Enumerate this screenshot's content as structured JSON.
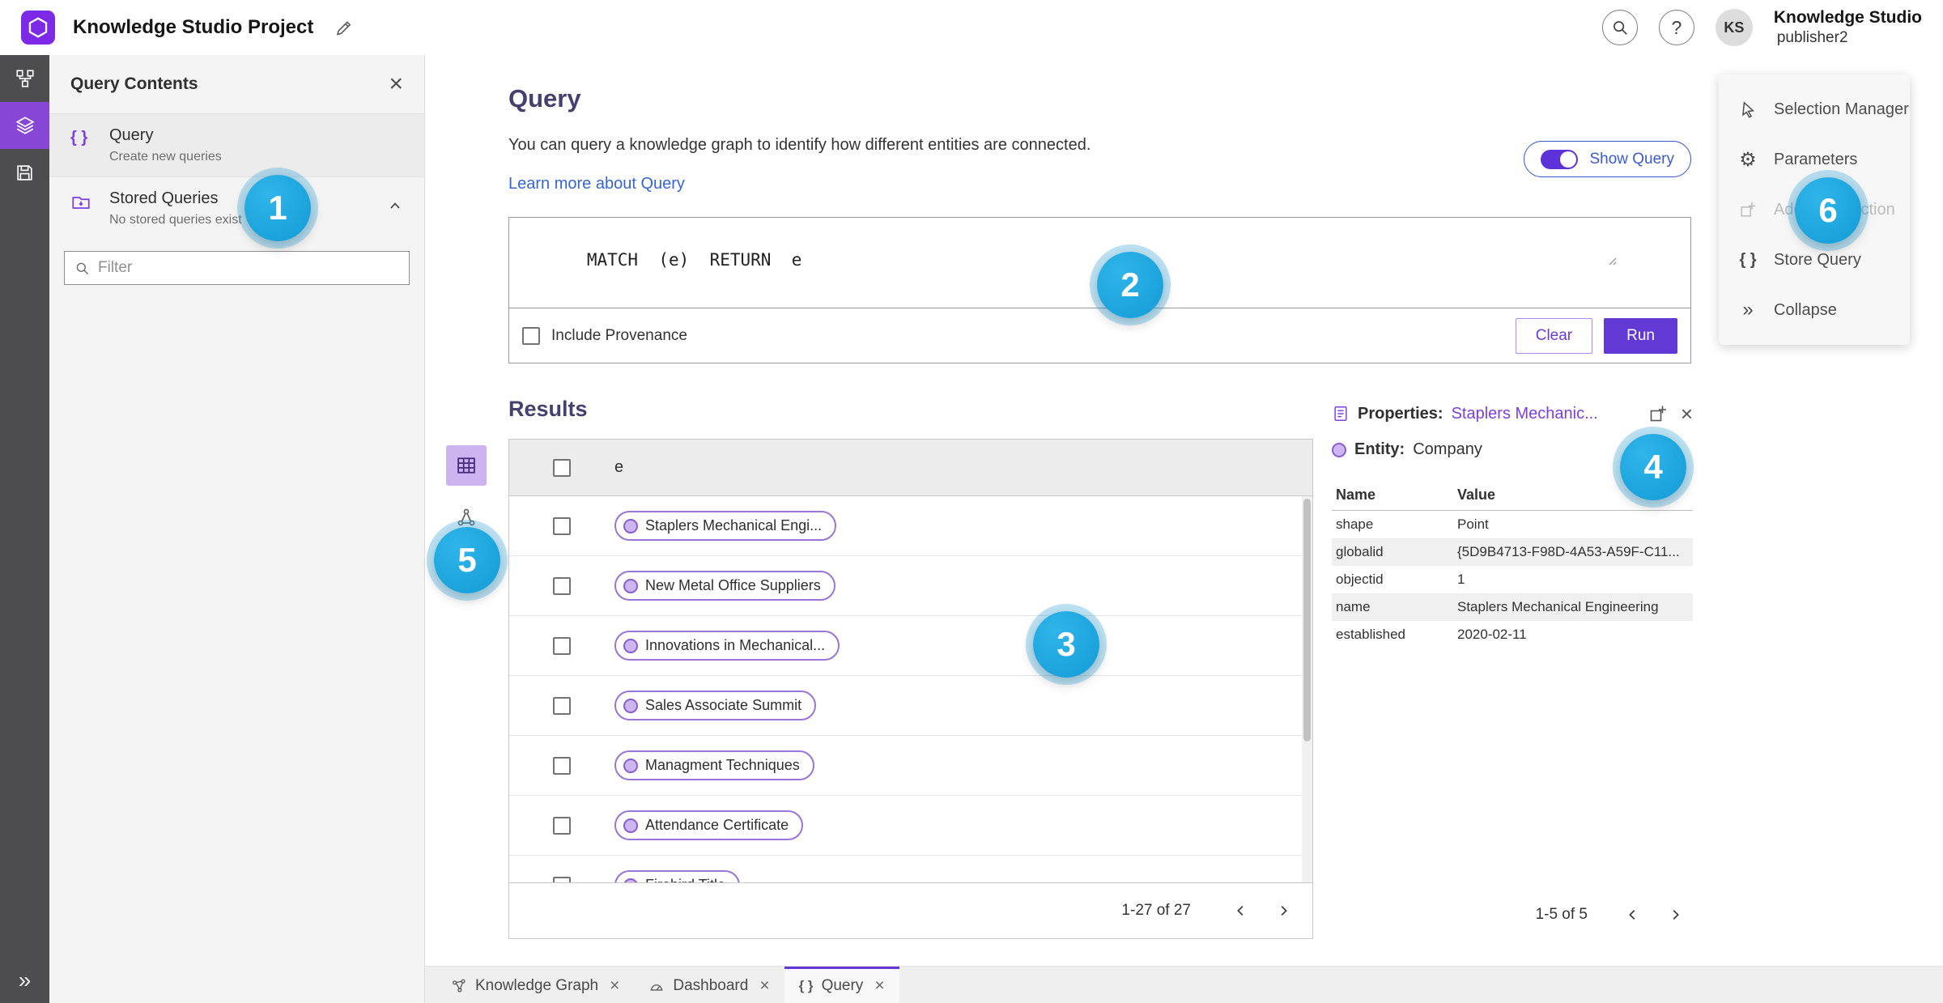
{
  "topbar": {
    "title": "Knowledge Studio Project",
    "help_glyph": "?",
    "avatar_initials": "KS",
    "user_name": "Knowledge Studio",
    "user_role": "publisher2"
  },
  "icons": {
    "close": "×",
    "collapse": "»",
    "braces": "{ }",
    "gear": "⚙"
  },
  "left_panel": {
    "title": "Query Contents",
    "items": [
      {
        "label": "Query",
        "sublabel": "Create new queries"
      },
      {
        "label": "Stored Queries",
        "sublabel": "No stored queries exist"
      }
    ],
    "filter_placeholder": "Filter"
  },
  "query": {
    "heading": "Query",
    "description": "You can query a knowledge graph to identify how different entities are connected.",
    "learn_more": "Learn more about Query",
    "show_query": "Show Query",
    "code": "MATCH  (e)  RETURN  e",
    "include_provenance": "Include Provenance",
    "clear": "Clear",
    "run": "Run"
  },
  "results": {
    "heading": "Results",
    "column_e": "e",
    "rows": [
      "Staplers Mechanical Engi...",
      "New Metal Office Suppliers",
      "Innovations in Mechanical...",
      "Sales Associate Summit",
      "Managment Techniques",
      "Attendance Certificate",
      "Firebird Title"
    ],
    "pagination": "1-27 of 27"
  },
  "properties": {
    "label": "Properties:",
    "selected_entity": "Staplers Mechanic...",
    "entity_label": "Entity:",
    "entity_type": "Company",
    "col_name": "Name",
    "col_value": "Value",
    "rows": [
      {
        "name": "shape",
        "value": "Point"
      },
      {
        "name": "globalid",
        "value": "{5D9B4713-F98D-4A53-A59F-C11..."
      },
      {
        "name": "objectid",
        "value": "1"
      },
      {
        "name": "name",
        "value": "Staplers Mechanical Engineering"
      },
      {
        "name": "established",
        "value": "2020-02-11"
      }
    ],
    "pagination": "1-5 of 5"
  },
  "right_menu": {
    "items": [
      {
        "label": "Selection Manager"
      },
      {
        "label": "Parameters"
      },
      {
        "label": "Add To Selection"
      },
      {
        "label": "Store Query"
      },
      {
        "label": "Collapse"
      }
    ]
  },
  "tabs": [
    {
      "label": "Knowledge Graph"
    },
    {
      "label": "Dashboard"
    },
    {
      "label": "Query"
    }
  ],
  "badges": [
    "1",
    "2",
    "3",
    "4",
    "5",
    "6"
  ],
  "colors": {
    "accent_purple": "#6339d6",
    "chip_purple": "#9b74d8",
    "link_blue": "#3565d6",
    "badge_blue": "#1ea7e0",
    "rail_dark": "#4d4d50",
    "rail_selected": "#8746d6"
  }
}
